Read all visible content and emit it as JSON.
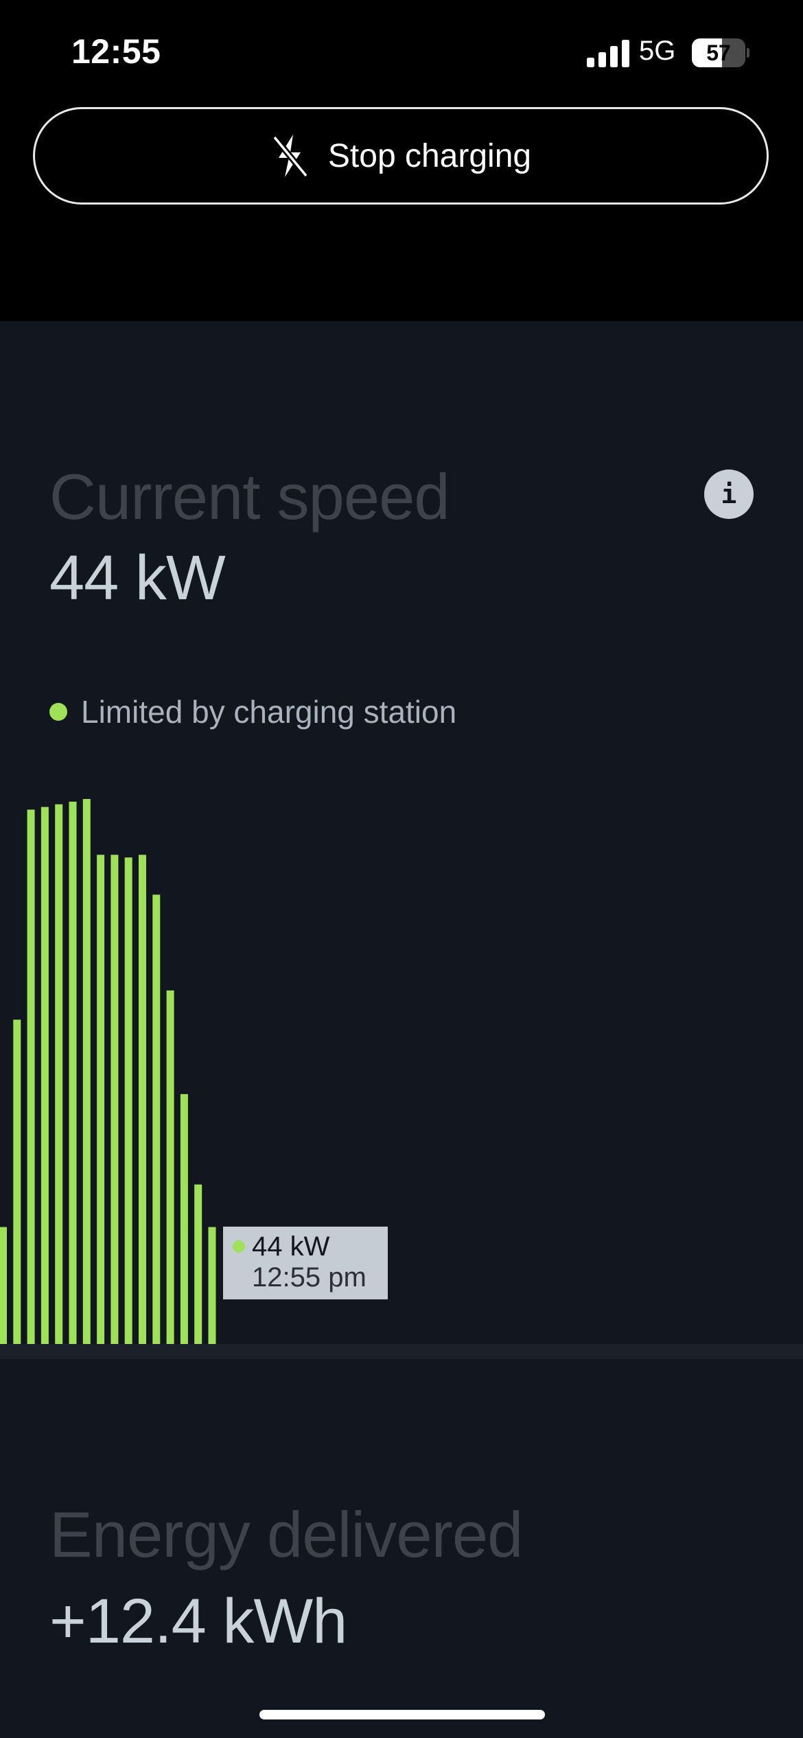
{
  "status_bar": {
    "time": "12:55",
    "network": "5G",
    "battery_level": "57",
    "battery_fraction": 0.57
  },
  "stop_button": {
    "label": "Stop charging",
    "icon": "bolt-slash-icon"
  },
  "current_speed": {
    "title": "Current speed",
    "value": "44 kW",
    "info_label": "i",
    "limit_text": "Limited by charging station"
  },
  "chart_data": {
    "type": "bar",
    "title": "",
    "xlabel": "",
    "ylabel": "",
    "ylim": [
      0,
      205
    ],
    "values": [
      44,
      122,
      201,
      202,
      203,
      204,
      205,
      184,
      184,
      183,
      184,
      169,
      133,
      94,
      60,
      44
    ],
    "tooltip": {
      "value": "44 kW",
      "time": "12:55 pm"
    }
  },
  "energy_delivered": {
    "title": "Energy delivered",
    "value": "+12.4 kWh"
  },
  "colors": {
    "accent": "#9fe25a",
    "panel_bg": "#12161e",
    "title_muted": "#3c434d",
    "value_text": "#c9d1db"
  }
}
